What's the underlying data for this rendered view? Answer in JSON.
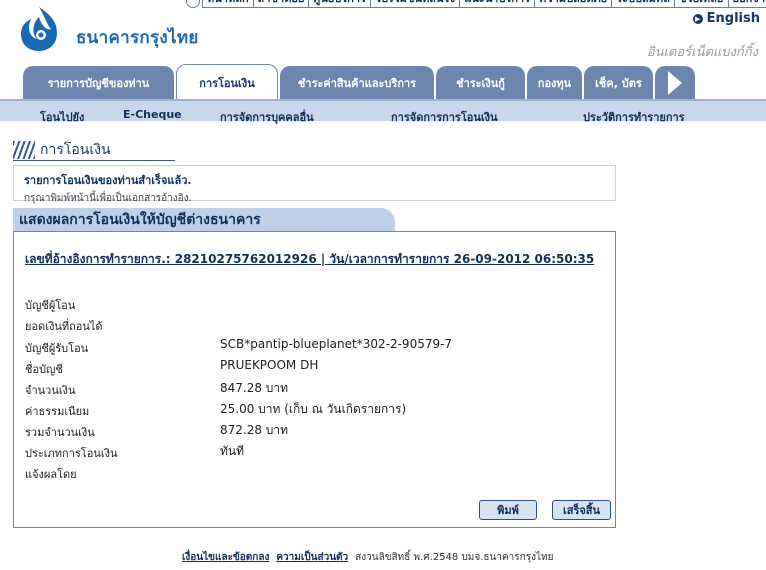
{
  "top_links": [
    "หน้าหลัก",
    "สาขาต่อย",
    "ศูนย์บริการ",
    "โปรโมชั่นที่สนใจ",
    "แนะนำบริการ",
    "ความปลอดภัย",
    "ระบบสัมคส์",
    "ช่วยเหลือ",
    "ออกจากระบบ"
  ],
  "header": {
    "bank_name": "ธนาคารกรุงไทย",
    "english_label": "English",
    "tagline": "อินเตอร์เน็ตแบงก์กิ้ง"
  },
  "main_tabs": [
    {
      "label": "รายการบัญชีของท่าน",
      "active": false
    },
    {
      "label": "การโอนเงิน",
      "active": true
    },
    {
      "label": "ชำระค่าสินค้าและบริการ",
      "active": false
    },
    {
      "label": "ชำระเงินกู้",
      "active": false
    },
    {
      "label": "กองทุน",
      "active": false
    },
    {
      "label": "เช็ค, บัตร",
      "active": false
    }
  ],
  "sub_nav": [
    "โอนไปยัง",
    "E-Cheque",
    "การจัดการบุคคลอื่น",
    "การจัดการการโอนเงิน",
    "ประวัติการทำรายการ"
  ],
  "page": {
    "title": "การโอนเงิน",
    "success_title": "รายการโอนเงินของท่านสำเร็จแล้ว.",
    "success_subtitle": "กรุณาพิมพ์หน้านี้เพื่อเป็นเอกสารอ้างอิง."
  },
  "result": {
    "title": "แสดงผลการโอนเงินให้บัญชีต่างธนาคาร",
    "reference_line": "เลขที่อ้างอิงการทำรายการ.: 28210275762012926 | วัน/เวลาการทำรายการ 26-09-2012 06:50:35",
    "rows": [
      {
        "label": "บัญชีผู้โอน",
        "value": ""
      },
      {
        "label": "ยอดเงินที่ถอนได้",
        "value": ""
      },
      {
        "label": "บัญชีผู้รับโอน",
        "value": "SCB*pantip-blueplanet*302-2-90579-7"
      },
      {
        "label": "ชื่อบัญชี",
        "value": "PRUEKPOOM DH"
      },
      {
        "label": "จำนวนเงิน",
        "value": "847.28 บาท"
      },
      {
        "label": "ค่าธรรมเนียม",
        "value": "25.00 บาท  (เก็บ ณ วันเกิดรายการ)"
      },
      {
        "label": "รวมจำนวนเงิน",
        "value": "872.28 บาท"
      },
      {
        "label": "ประเภทการโอนเงิน",
        "value": "ทันที"
      },
      {
        "label": "แจ้งผลโดย",
        "value": ""
      }
    ],
    "print_label": "พิมพ์",
    "done_label": "เสร็จสิ้น"
  },
  "footer": {
    "terms_link": "เงื่อนไขและข้อตกลง",
    "privacy_link": "ความเป็นส่วนตัว",
    "copyright": "สงวนลิขสิทธิ์ พ.ศ.2548 บมจ.ธนาคารกรุงไทย"
  },
  "colors": {
    "brand_blue": "#1a6ab3",
    "tab_blue": "#6e85ad",
    "nav_light": "#c9d7ea",
    "text_navy": "#12305e"
  },
  "icons": [
    "home-circle-icon",
    "bird-logo-icon",
    "right-arrow-icon",
    "stripes-icon"
  ]
}
